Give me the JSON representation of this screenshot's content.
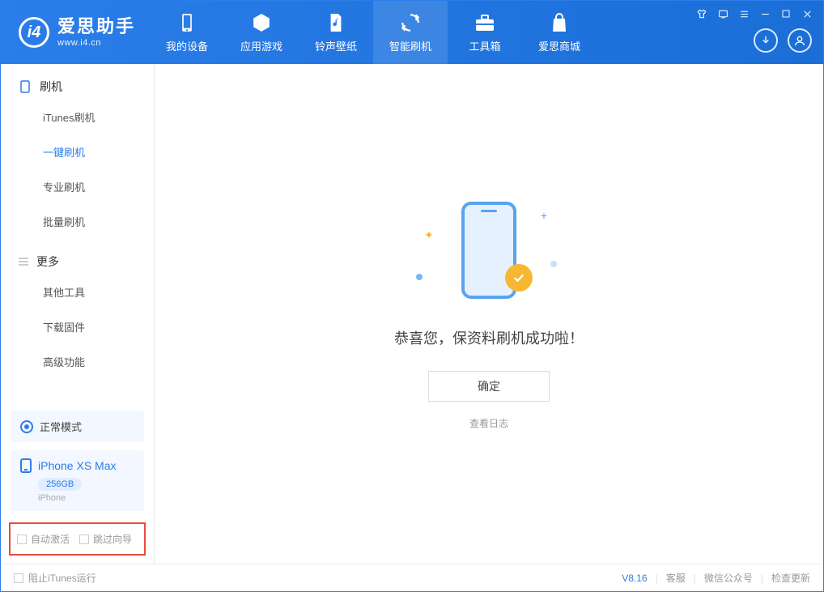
{
  "app": {
    "name": "爱思助手",
    "url": "www.i4.cn"
  },
  "nav": {
    "tabs": [
      {
        "label": "我的设备"
      },
      {
        "label": "应用游戏"
      },
      {
        "label": "铃声壁纸"
      },
      {
        "label": "智能刷机"
      },
      {
        "label": "工具箱"
      },
      {
        "label": "爱思商城"
      }
    ]
  },
  "sidebar": {
    "section1": "刷机",
    "items1": [
      "iTunes刷机",
      "一键刷机",
      "专业刷机",
      "批量刷机"
    ],
    "section2": "更多",
    "items2": [
      "其他工具",
      "下载固件",
      "高级功能"
    ]
  },
  "device": {
    "mode": "正常模式",
    "name": "iPhone XS Max",
    "capacity": "256GB",
    "type": "iPhone"
  },
  "options": {
    "auto_activate": "自动激活",
    "skip_guide": "跳过向导"
  },
  "main": {
    "success_message": "恭喜您，保资料刷机成功啦！",
    "ok_button": "确定",
    "view_log": "查看日志"
  },
  "statusbar": {
    "block_itunes": "阻止iTunes运行",
    "version": "V8.16",
    "links": [
      "客服",
      "微信公众号",
      "检查更新"
    ]
  }
}
